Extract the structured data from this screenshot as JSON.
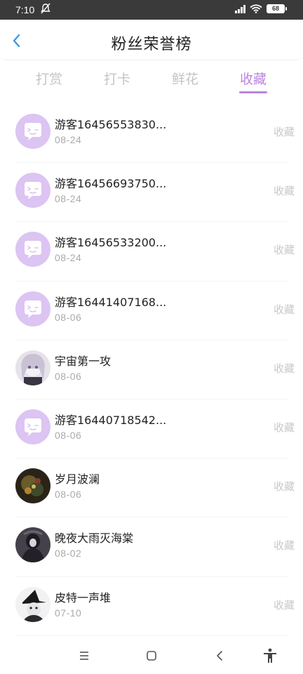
{
  "status_bar": {
    "time": "7:10",
    "battery": "68"
  },
  "header": {
    "title": "粉丝荣誉榜"
  },
  "tabs": [
    {
      "label": "打赏",
      "active": false
    },
    {
      "label": "打卡",
      "active": false
    },
    {
      "label": "鲜花",
      "active": false
    },
    {
      "label": "收藏",
      "active": true
    }
  ],
  "colors": {
    "accent": "#b985df",
    "avatar_bg": "#dcc4f3"
  },
  "rows": [
    {
      "name": "游客16456553830...",
      "date": "08-24",
      "action": "收藏",
      "avatar": "default-avatar"
    },
    {
      "name": "游客16456693750...",
      "date": "08-24",
      "action": "收藏",
      "avatar": "default-avatar"
    },
    {
      "name": "游客16456533200...",
      "date": "08-24",
      "action": "收藏",
      "avatar": "default-avatar"
    },
    {
      "name": "游客16441407168...",
      "date": "08-06",
      "action": "收藏",
      "avatar": "default-avatar"
    },
    {
      "name": "宇宙第一攻",
      "date": "08-06",
      "action": "收藏",
      "avatar": "photo-avatar"
    },
    {
      "name": "游客16440718542...",
      "date": "08-06",
      "action": "收藏",
      "avatar": "default-avatar"
    },
    {
      "name": "岁月波澜",
      "date": "08-06",
      "action": "收藏",
      "avatar": "photo-avatar"
    },
    {
      "name": "晚夜大雨灭海棠",
      "date": "08-02",
      "action": "收藏",
      "avatar": "photo-avatar"
    },
    {
      "name": "皮特一声堆",
      "date": "07-10",
      "action": "收藏",
      "avatar": "photo-avatar"
    }
  ]
}
